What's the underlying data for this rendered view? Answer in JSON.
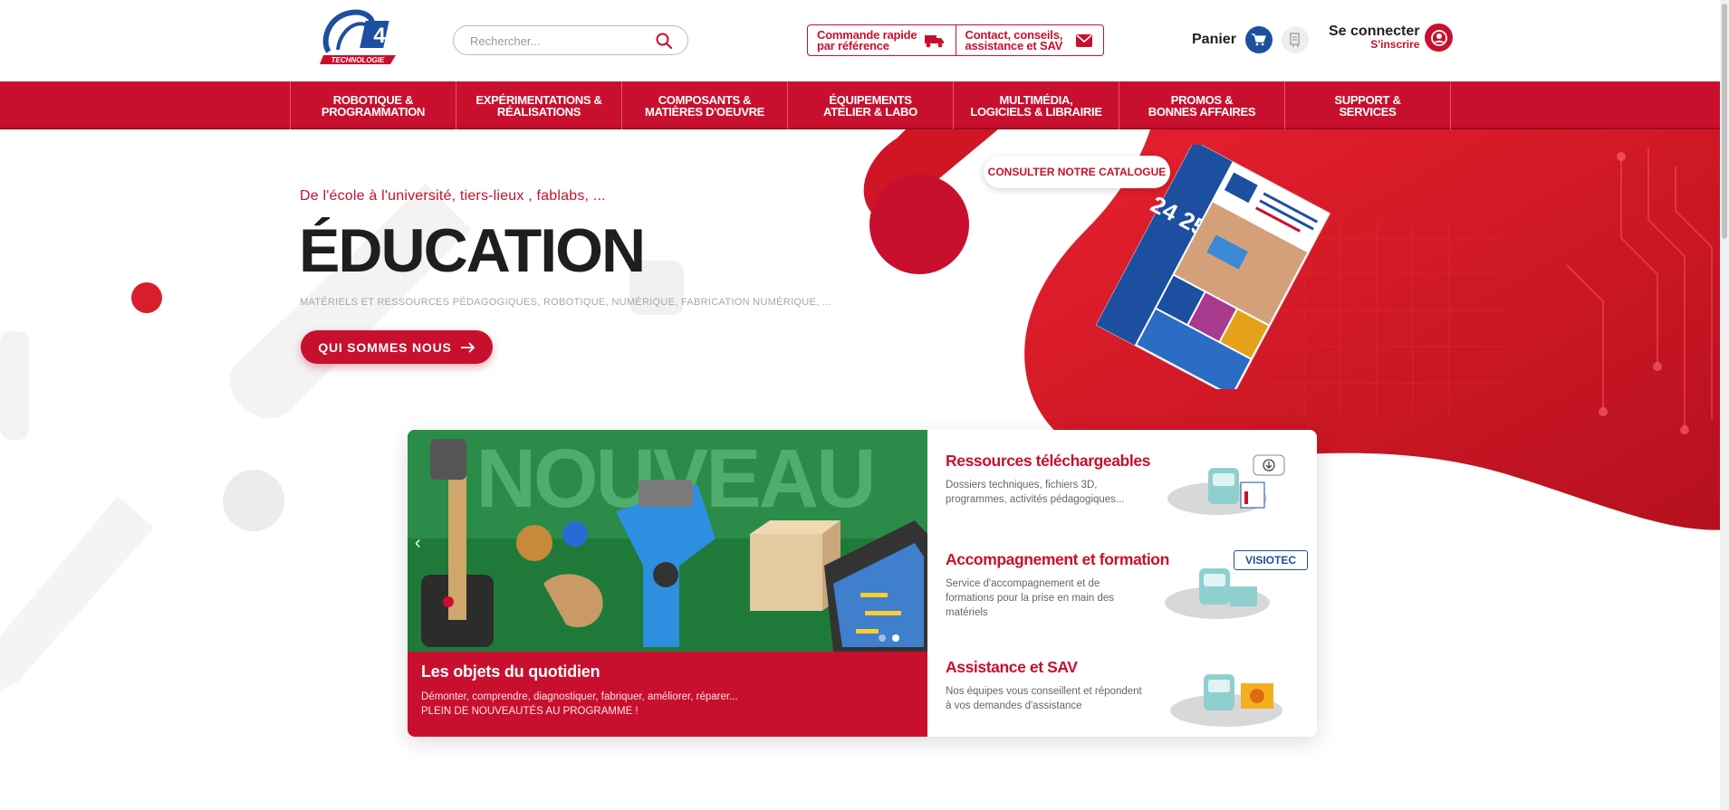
{
  "header": {
    "logo_text": "A4 TECHNOLOGIE",
    "search": {
      "placeholder": "Rechercher..."
    },
    "quick_order": "Commande rapide\npar référence",
    "contact": "Contact, conseils,\nassistance et SAV",
    "cart_label": "Panier",
    "login_label": "Se connecter",
    "register_label": "S'inscrire"
  },
  "nav": {
    "items": [
      "ROBOTIQUE &\nPROGRAMMATION",
      "EXPÉRIMENTATIONS &\nRÉALISATIONS",
      "COMPOSANTS &\nMATIÈRES D'OEUVRE",
      "ÉQUIPEMENTS\nATELIER & LABO",
      "MULTIMÉDIA,\nLOGICIELS & LIBRAIRIE",
      "PROMOS &\nBONNES AFFAIRES",
      "SUPPORT &\nSERVICES"
    ]
  },
  "hero": {
    "subtitle": "De l'école à l'université, tiers-lieux , fablabs, ...",
    "title": "ÉDUCATION",
    "tagline": "MATÉRIELS ET RESSOURCES PÉDAGOGIQUES, ROBOTIQUE, NUMÉRIQUE, FABRICATION NUMÉRIQUE, ...",
    "cta_label": "QUI SOMMES NOUS",
    "catalog_label": "CONSULTER NOTRE CATALOGUE",
    "catalog_years": "24 25"
  },
  "slider": {
    "banner_text": "NOUVEAU",
    "title": "Les objets du quotidien",
    "desc_line1": "Démonter, comprendre, diagnostiquer, fabriquer, améliorer, réparer...",
    "desc_line2": "PLEIN DE NOUVEAUTÉS AU PROGRAMME !",
    "active_slide": 2,
    "slide_count": 2
  },
  "services": [
    {
      "title": "Ressources téléchargeables",
      "desc": "Dossiers techniques, fichiers 3D, programmes, activités pédagogiques..."
    },
    {
      "title": "Accompagnement et formation",
      "desc": "Service d'accompagnement et de formations pour la prise en main des matériels"
    },
    {
      "title": "Assistance et SAV",
      "desc": "Nos équipes vous conseillent et répondent à vos demandes d'assistance"
    }
  ],
  "visiotec": "VISIOTEC",
  "colors": {
    "brand_red": "#c8102e",
    "brand_blue": "#1d4fa0",
    "slide_green": "#1f7a3a"
  }
}
